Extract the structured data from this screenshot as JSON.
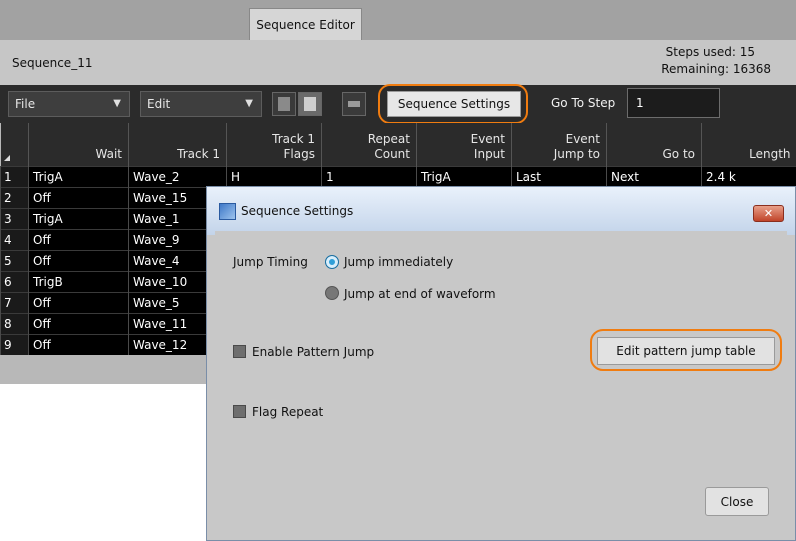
{
  "tab": {
    "label": "Sequence Editor"
  },
  "header": {
    "sequence_name": "Sequence_11",
    "steps_used": "Steps used: 15",
    "remaining": "Remaining: 16368"
  },
  "toolbar": {
    "file_label": "File",
    "edit_label": "Edit",
    "sequence_settings_label": "Sequence Settings",
    "goto_label": "Go To Step",
    "goto_value": "1"
  },
  "grid": {
    "columns": [
      "",
      "Wait",
      "Track 1",
      "Track 1\nFlags",
      "Repeat\nCount",
      "Event\nInput",
      "Event\nJump to",
      "Go to",
      "Length"
    ],
    "rows": [
      {
        "num": "1",
        "wait": "TrigA",
        "track": "Wave_2",
        "flags": "H",
        "repeat": "1",
        "event": "TrigA",
        "jump": "Last",
        "goto": "Next",
        "length": "2.4 k"
      },
      {
        "num": "2",
        "wait": "Off",
        "track": "Wave_15"
      },
      {
        "num": "3",
        "wait": "TrigA",
        "track": "Wave_1"
      },
      {
        "num": "4",
        "wait": "Off",
        "track": "Wave_9"
      },
      {
        "num": "5",
        "wait": "Off",
        "track": "Wave_4"
      },
      {
        "num": "6",
        "wait": "TrigB",
        "track": "Wave_10"
      },
      {
        "num": "7",
        "wait": "Off",
        "track": "Wave_5"
      },
      {
        "num": "8",
        "wait": "Off",
        "track": "Wave_11"
      },
      {
        "num": "9",
        "wait": "Off",
        "track": "Wave_12"
      }
    ]
  },
  "dialog": {
    "title": "Sequence Settings",
    "close_x": "✕",
    "jump_timing_label": "Jump Timing",
    "jump_immediately": "Jump immediately",
    "jump_end": "Jump at end of waveform",
    "enable_pattern_jump": "Enable Pattern Jump",
    "edit_pattern_jump_table": "Edit pattern jump table",
    "flag_repeat": "Flag Repeat",
    "close": "Close"
  },
  "colors": {
    "highlight": "#f07c10",
    "radio_selected": "#2f9fd8"
  }
}
